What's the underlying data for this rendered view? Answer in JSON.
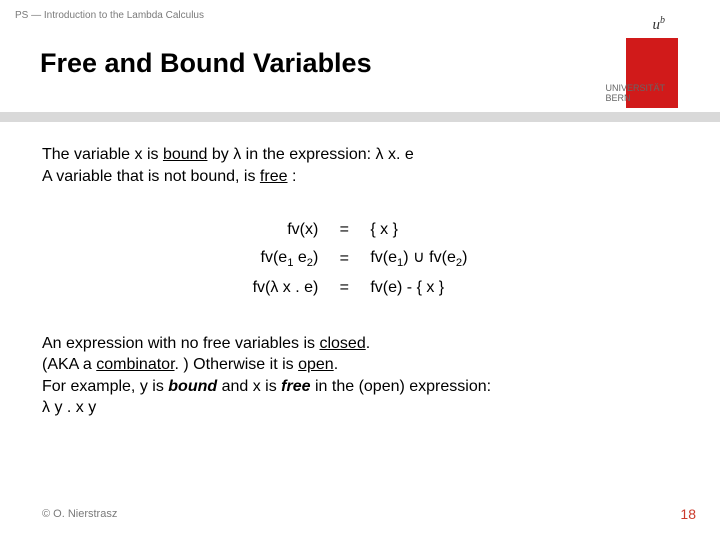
{
  "header": {
    "course_label": "PS — Introduction to the Lambda Calculus",
    "title": "Free and Bound Variables",
    "logo": {
      "u_sup": "u",
      "sup": "b",
      "uni_line1": "UNIVERSITÄT",
      "uni_line2": "BERN"
    }
  },
  "intro": {
    "line1_a": "The variable x is ",
    "line1_bound": "bound",
    "line1_b": " by λ in the expression: λ x. e",
    "line2_a": "A variable that is not bound, is ",
    "line2_free": "free",
    "line2_b": " :"
  },
  "equations": [
    {
      "lhs": "fv(x)",
      "op": "=",
      "rhs": "{ x }"
    },
    {
      "lhs": "fv(e₁ e₂)",
      "op": "=",
      "rhs": "fv(e₁) ∪ fv(e₂)"
    },
    {
      "lhs": "fv(λ x . e)",
      "op": "=",
      "rhs": "fv(e) - { x }"
    }
  ],
  "closing": {
    "l1_a": "An expression with no free variables is ",
    "l1_closed": "closed",
    "l1_b": ".",
    "l2_a": "(AKA a ",
    "l2_comb": "combinator",
    "l2_b": ". ) Otherwise it is ",
    "l2_open": "open",
    "l2_c": ".",
    "l3_a": "For example, y is ",
    "l3_bound": "bound",
    "l3_b": " and x is ",
    "l3_free": "free",
    "l3_c": " in the (open) expression:",
    "l4": "λ y . x y"
  },
  "footer": {
    "left": "© O. Nierstrasz",
    "right": "18"
  }
}
